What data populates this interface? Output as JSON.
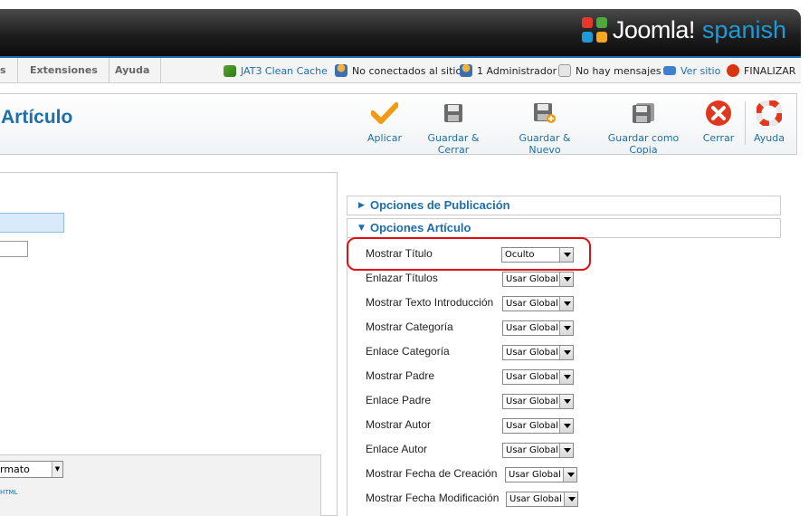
{
  "brand": {
    "name": "Joomla!",
    "lang": "spanish"
  },
  "menu": {
    "item_cut": "s",
    "extensiones": "Extensiones",
    "ayuda": "Ayuda"
  },
  "status": {
    "cache": "JAT3 Clean Cache",
    "users": "No conectados al sitio",
    "admins": "1 Administrador",
    "messages": "No hay mensajes",
    "view_site": "Ver sitio",
    "logout": "FINALIZAR"
  },
  "page_title": "Artículo",
  "toolbar": {
    "apply": "Aplicar",
    "save_close": "Guardar & Cerrar",
    "save_new": "Guardar & Nuevo",
    "save_copy": "Guardar como Copia",
    "close": "Cerrar",
    "help": "Ayuda"
  },
  "left": {
    "format_select": "rmato",
    "format_note": "HTML"
  },
  "panels": {
    "publishing": "Opciones de Publicación",
    "article": "Opciones Artículo"
  },
  "options": [
    {
      "label": "Mostrar Título",
      "value": "Oculto"
    },
    {
      "label": "Enlazar Títulos",
      "value": "Usar Global"
    },
    {
      "label": "Mostrar Texto Introducción",
      "value": "Usar Global"
    },
    {
      "label": "Mostrar Categoría",
      "value": "Usar Global"
    },
    {
      "label": "Enlace Categoría",
      "value": "Usar Global"
    },
    {
      "label": "Mostrar Padre",
      "value": "Usar Global"
    },
    {
      "label": "Enlace Padre",
      "value": "Usar Global"
    },
    {
      "label": "Mostrar Autor",
      "value": "Usar Global"
    },
    {
      "label": "Enlace Autor",
      "value": "Usar Global"
    },
    {
      "label": "Mostrar Fecha de Creación",
      "value": "Usar Global"
    },
    {
      "label": "Mostrar Fecha Modificación",
      "value": "Usar Global"
    }
  ],
  "colors": {
    "accent": "#1c6fa8",
    "highlight": "#e01010",
    "apply": "#f29a12",
    "close": "#e2371f"
  }
}
